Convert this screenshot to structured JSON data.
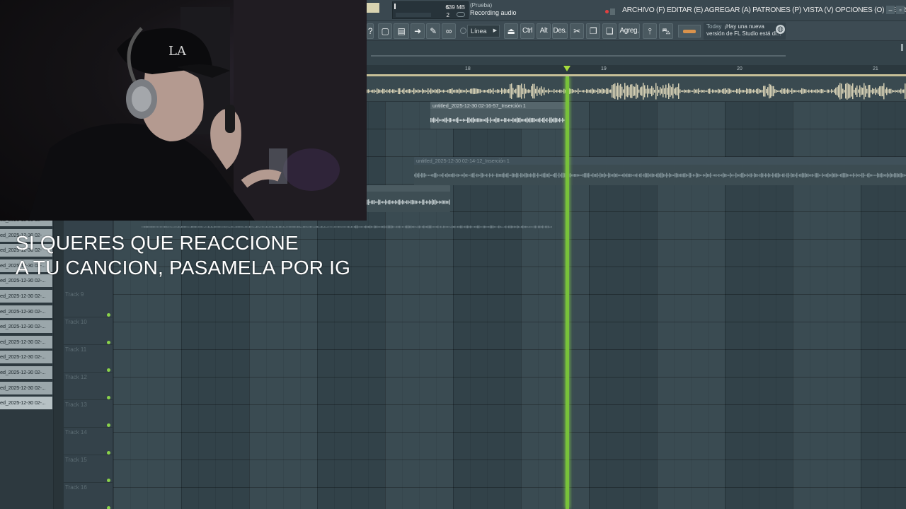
{
  "topbar": {
    "meter_top": "5",
    "memory": "639 MB",
    "meter_bottom": "2",
    "hint_line1": "(Prueba)",
    "hint_line2": "Recording audio",
    "menu": "ARCHIVO (F) EDITAR (E) AGREGAR (A) PATRONES (P) VISTA (V) OPCIONES (O) HERRAMIENTAS (T) AYUDA",
    "win_min": "–",
    "win_max": "▫"
  },
  "toolbar": {
    "help_icon": "?",
    "snap_mode": "Línea",
    "ctrl": "Ctrl",
    "alt": "Alt",
    "des": "Des.",
    "agreg": "Agreg.",
    "news_today": "Today",
    "news_text": "¡Hay una nueva versión de FL Studio está di..."
  },
  "ruler": {
    "marks": [
      "18",
      "19",
      "20",
      "21"
    ]
  },
  "clips": {
    "clip1_title": "untitled_2025-12-30 02-16-57_Inserción 1",
    "clip2_title": "untitled_2025-12-30 02-14-12_Inserción 1"
  },
  "browser": {
    "items": [
      "ed_2025-12-30 02-",
      "ed_2025-12-30 02-",
      "ed_2025-12-30 02-",
      "ed_2025-12-30 02-...",
      "ed_2025-12-30 02-...",
      "ed_2025-12-30 02-...",
      "ed_2025-12-30 02-...",
      "ed_2025-12-30 02-...",
      "ed_2025-12-30 02-...",
      "ed_2025-12-30 02-...",
      "ed_2025-12-30 02-...",
      "ed_2025-12-30 02-...",
      "ed_2025-12-30 02-..."
    ]
  },
  "tracks": {
    "names": [
      "Track 9",
      "Track 10",
      "Track 11",
      "Track 12",
      "Track 13",
      "Track 14",
      "Track 15",
      "Track 16"
    ]
  },
  "caption": {
    "line1": "SI QUERES QUE REACCIONE",
    "line2": "A TU CANCION, PASAMELA POR IG"
  },
  "colors": {
    "playhead": "#78c23a",
    "track_dot": "#8ad24a",
    "waveform": "#d8d3b8"
  },
  "icons": {
    "webcam": "streamer-webcam-feed",
    "globe": "globe-icon"
  }
}
